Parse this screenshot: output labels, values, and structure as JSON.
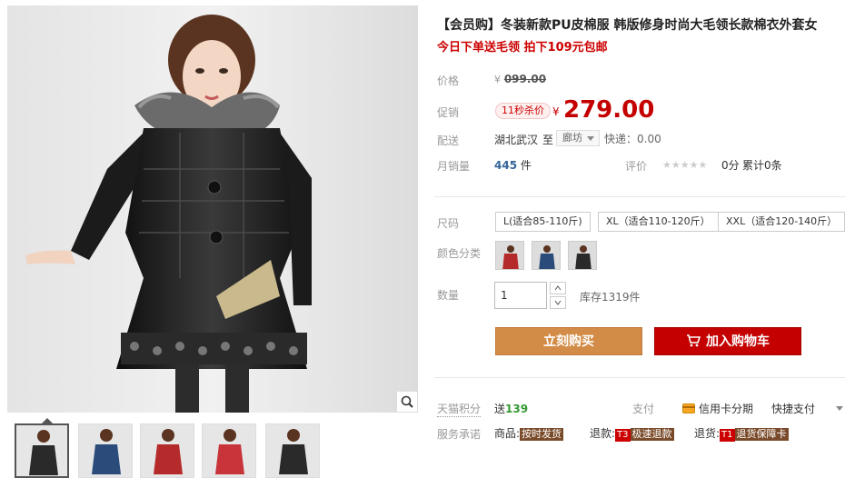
{
  "product": {
    "title": "【会员购】冬装新款PU皮棉服 韩版修身时尚大毛领长款棉衣外套女",
    "subtitle": "今日下单送毛领 拍下109元包邮"
  },
  "price": {
    "label": "价格",
    "yen": "¥",
    "original": "099.00",
    "promo_label": "促销",
    "promo_badge": "11秒杀价",
    "promo_yen": "¥",
    "promo_price": "279.00"
  },
  "shipping": {
    "label": "配送",
    "from": "湖北武汉",
    "to_word": "至",
    "to_city": "廊坊",
    "fee_label": "快递：",
    "fee": "0.00"
  },
  "sales": {
    "label": "月销量",
    "count": "445",
    "unit": "件",
    "rating_label": "评价",
    "stars": "★★★★★",
    "score": "0分",
    "total": "累计0条"
  },
  "sku": {
    "size_label": "尺码",
    "sizes": [
      "L(适合85-110斤)",
      "XL（适合110-120斤）",
      "XXL（适合120-140斤）"
    ],
    "color_label": "颜色分类",
    "colors": [
      {
        "name": "red",
        "hex": "#b52a2a"
      },
      {
        "name": "blue",
        "hex": "#2b4c7a"
      },
      {
        "name": "black",
        "hex": "#2a2a2a"
      }
    ],
    "qty_label": "数量",
    "qty_value": "1",
    "stock": "库存1319件"
  },
  "actions": {
    "buy_now": "立刻购买",
    "add_cart": "加入购物车"
  },
  "service": {
    "points_label": "天猫积分",
    "points_prefix": "送",
    "points_value": "139",
    "pay_label": "支付",
    "credit": "信用卡分期",
    "quick": "快捷支付",
    "promise_label": "服务承诺",
    "goods_prefix": "商品:",
    "goods_tag": "按时发货",
    "refund_prefix": "退款:",
    "refund_t": "T3",
    "refund_tag": "极速退款",
    "return_prefix": "退货:",
    "return_t": "T1",
    "return_tag": "退货保障卡"
  },
  "gallery": {
    "thumbnail_colors": [
      "#2a2a2a",
      "#2b4c7a",
      "#b52a2a",
      "#c8343a",
      "#2a2a2a"
    ]
  },
  "colors": {
    "accent_red": "#c40000",
    "buy_orange": "#d38c47",
    "link_blue": "#336699"
  }
}
